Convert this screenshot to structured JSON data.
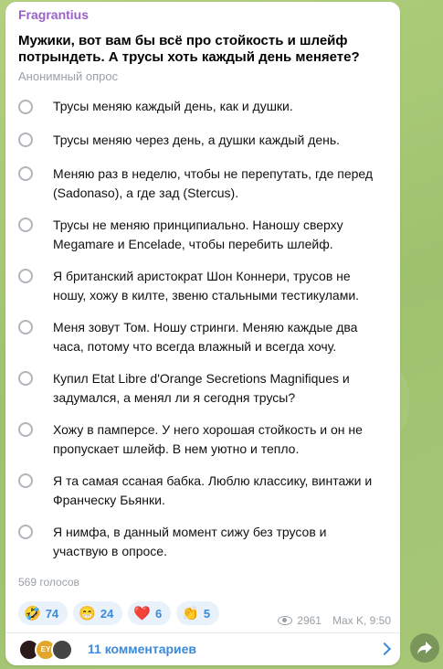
{
  "message": {
    "author": "Fragrantius",
    "question": "Мужики, вот вам бы всё про стойкость и шлейф потрындеть. А трусы хоть каждый день меняете?",
    "poll_type": "Анонимный опрос",
    "options": [
      {
        "text": "Трусы меняю каждый день, как и душки."
      },
      {
        "text": "Трусы меняю через день, а душки каждый день."
      },
      {
        "text": "Меняю раз в неделю, чтобы не перепутать, где перед (Sadonaso), а где зад (Stercus)."
      },
      {
        "text": "Трусы не меняю принципиально. Наношу сверху Megamare и Enceladе, чтобы перебить шлейф."
      },
      {
        "text": "Я британский аристократ Шон Коннери, трусов не ношу, хожу в килте, звеню стальными тестикулами."
      },
      {
        "text": "Меня зовут Том. Ношу стринги. Меняю каждые два часа, потому что всегда влажный и всегда хочу."
      },
      {
        "text": "Купил Etat Libre d'Orange Secretions Magnifiques и задумался, а менял ли я сегодня трусы?"
      },
      {
        "text": "Хожу в памперсе. У него хорошая стойкость и он не пропускает шлейф. В нем уютно и тепло."
      },
      {
        "text": "Я та самая ссаная бабка. Люблю классику, винтажи и Франческу Бьянки."
      },
      {
        "text": "Я нимфа, в данный момент сижу без трусов и участвую в опросе."
      }
    ],
    "votes": "569 голосов",
    "reactions": [
      {
        "emoji": "🤣",
        "count": "74"
      },
      {
        "emoji": "😁",
        "count": "24"
      },
      {
        "emoji": "❤️",
        "count": "6"
      },
      {
        "emoji": "👏",
        "count": "5"
      }
    ],
    "views": "2961",
    "signature_time": "Max K, 9:50",
    "comments_label": "11 комментариев",
    "avatar_badge": "EY"
  },
  "colors": {
    "author": "#9a62c9",
    "link": "#3b8ad9",
    "muted": "#9aa0a6",
    "background": "#a9c97a"
  }
}
